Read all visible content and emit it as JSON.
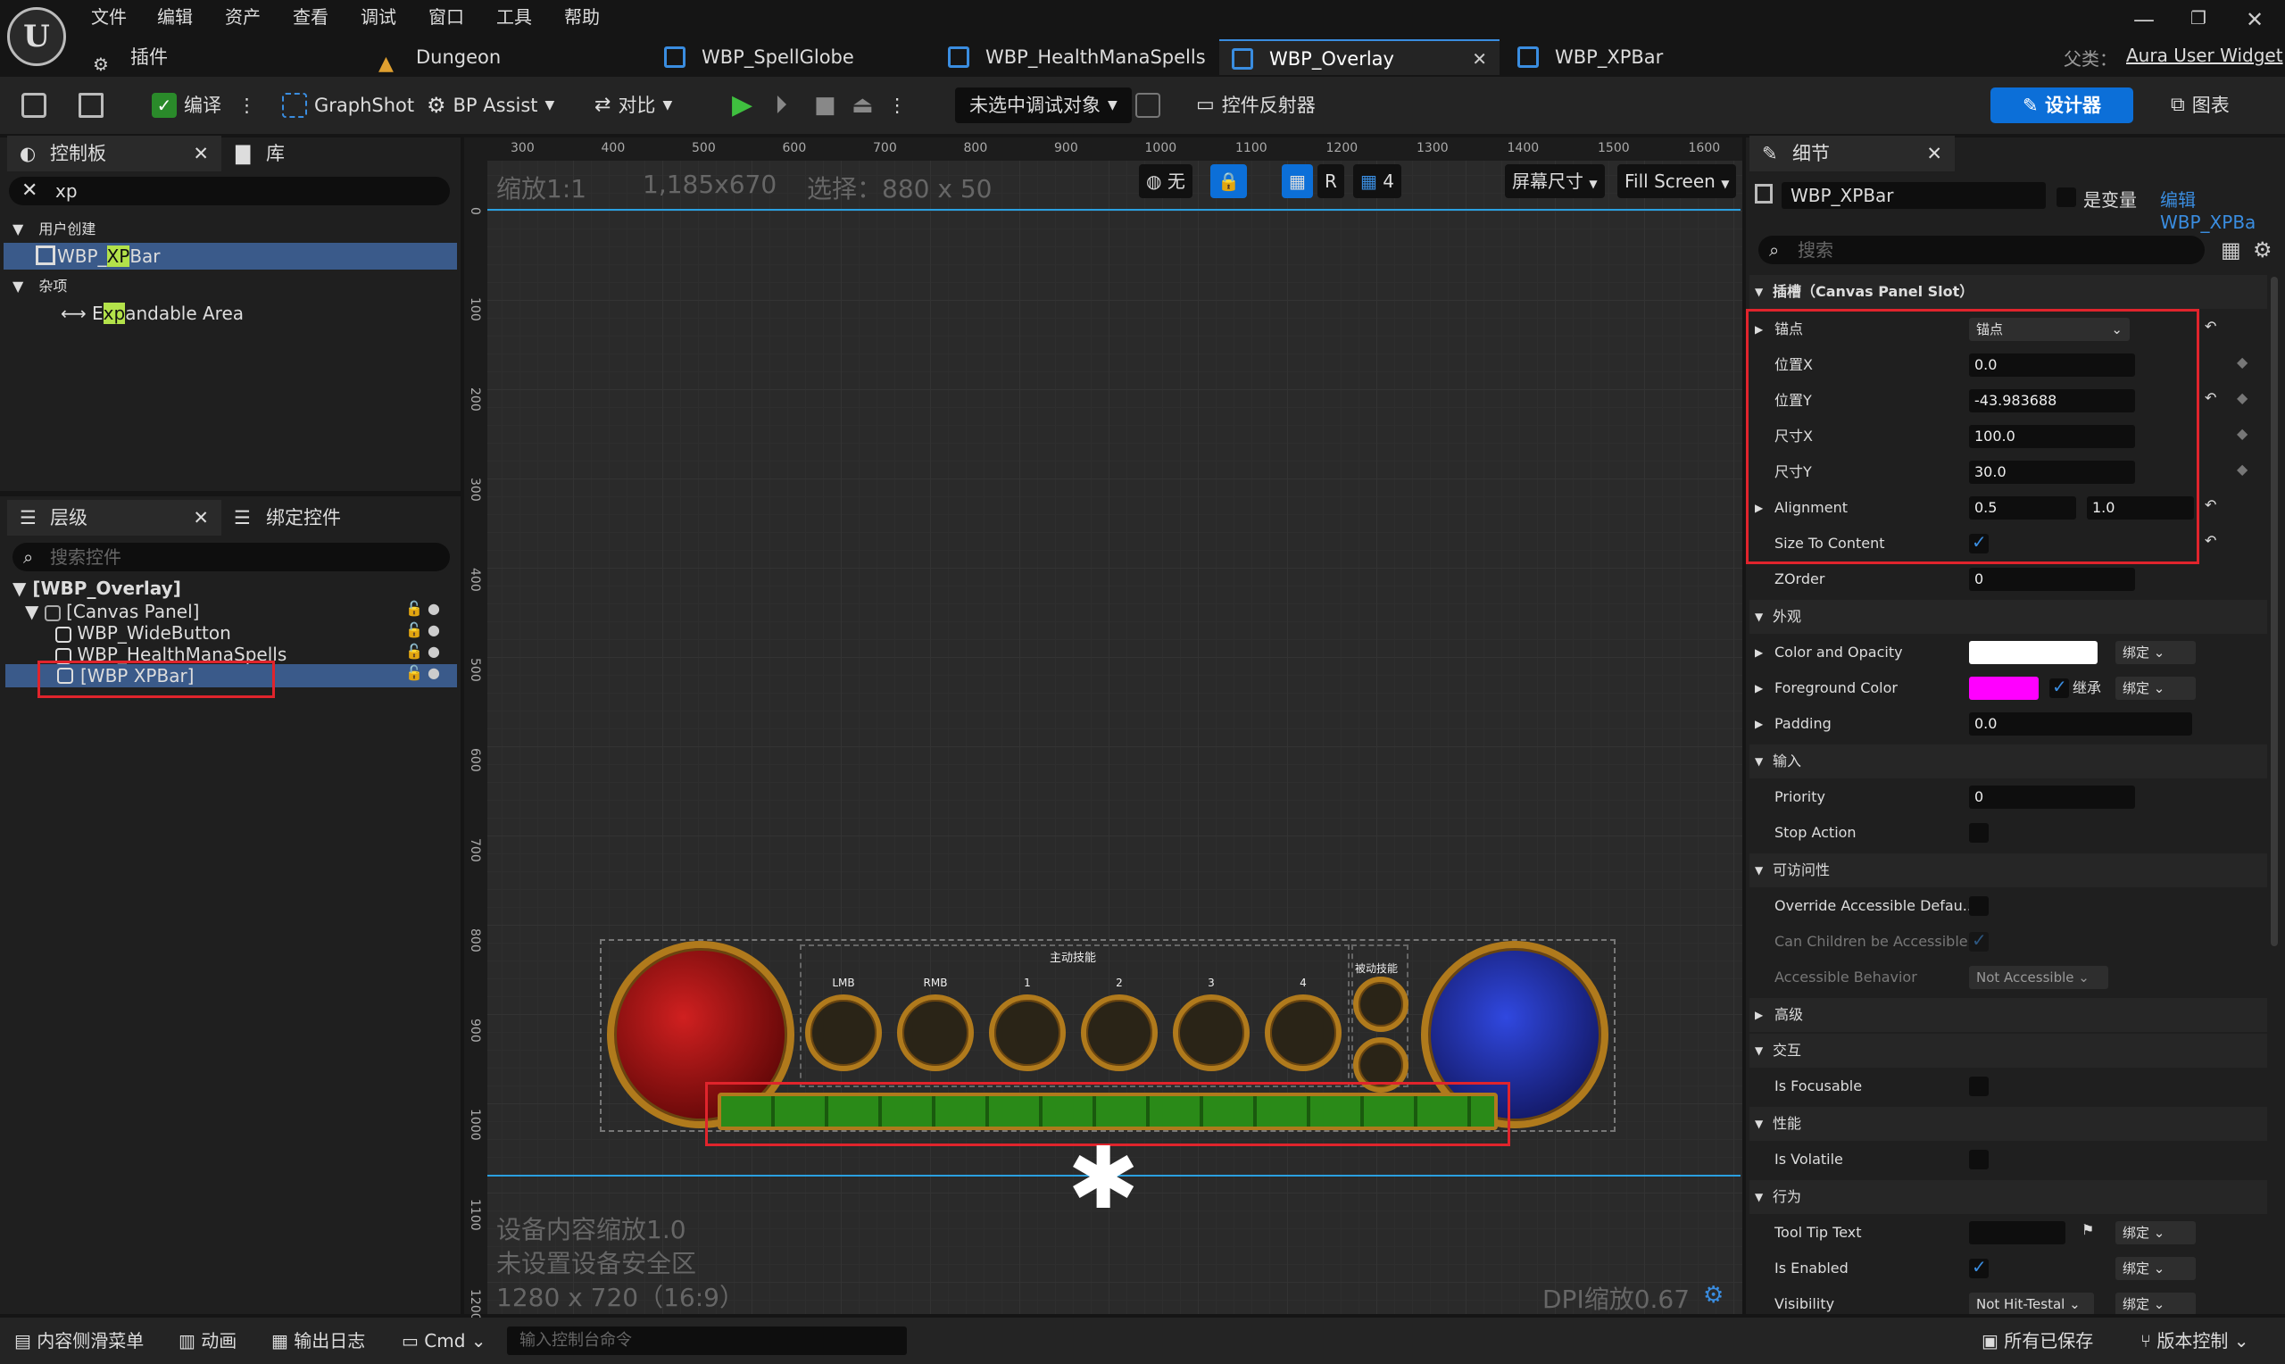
{
  "menu": [
    "文件",
    "编辑",
    "资产",
    "查看",
    "调试",
    "窗口",
    "工具",
    "帮助"
  ],
  "tabs": {
    "plugin": "插件",
    "dungeon": "Dungeon",
    "spellglobe": "WBP_SpellGlobe",
    "healthmana": "WBP_HealthManaSpells",
    "overlay": "WBP_Overlay",
    "xpbar": "WBP_XPBar"
  },
  "parent_label": "父类：",
  "parent_value": "Aura User Widget",
  "toolbar": {
    "compile": "编译",
    "graphshot": "GraphShot",
    "bpassist": "BP Assist",
    "diff": "对比",
    "debug": "未选中调试对象",
    "reflector": "控件反射器",
    "designer": "设计器",
    "graph": "图表"
  },
  "palette": {
    "tab": "控制板",
    "lib": "库",
    "search": "xp",
    "cat1": "用户创建",
    "item1_pre": "WBP_",
    "item1_hl": "XP",
    "item1_post": "Bar",
    "cat2": "杂项",
    "item2_pre": "E",
    "item2_hl": "xp",
    "item2_post": "andable Area"
  },
  "hierarchy": {
    "tab": "层级",
    "bind": "绑定控件",
    "search_placeholder": "搜索控件",
    "root": "[WBP_Overlay]",
    "canvas": "[Canvas Panel]",
    "w1": "WBP_WideButton",
    "w2": "WBP_HealthManaSpells",
    "w3": "[WBP XPBar]"
  },
  "viewport": {
    "zoom": "缩放1:1",
    "res": "1,185x670",
    "selection": "选择：880 x 50",
    "none": "无",
    "screen_size": "屏幕尺寸",
    "fill": "Fill Screen",
    "grid_num": "4",
    "r": "R",
    "scale": "设备内容缩放1.0",
    "safe": "未设置设备安全区",
    "resolution": "1280 x 720（16:9）",
    "dpi": "DPI缩放0.67",
    "ruler_h": [
      "300",
      "400",
      "500",
      "600",
      "700",
      "800",
      "900",
      "1000",
      "1100",
      "1200",
      "1300",
      "1400",
      "1500",
      "1600"
    ],
    "ruler_v": [
      "0",
      "100",
      "200",
      "300",
      "400",
      "500",
      "600",
      "700",
      "800",
      "900",
      "1000",
      "1100",
      "1200"
    ],
    "hud_active": "主动技能",
    "hud_passive": "被动技能",
    "slots": [
      "LMB",
      "RMB",
      "1",
      "2",
      "3",
      "4"
    ]
  },
  "details": {
    "tab": "细节",
    "name": "WBP_XPBar",
    "is_var": "是变量",
    "edit": "编辑WBP_XPBa",
    "search": "搜索",
    "slot_section": "插槽（Canvas Panel Slot）",
    "anchor_label": "锚点",
    "anchor_value": "锚点",
    "posx_label": "位置X",
    "posx": "0.0",
    "posy_label": "位置Y",
    "posy": "-43.983688",
    "sizex_label": "尺寸X",
    "sizex": "100.0",
    "sizey_label": "尺寸Y",
    "sizey": "30.0",
    "align_label": "Alignment",
    "align_x": "0.5",
    "align_y": "1.0",
    "stc_label": "Size To Content",
    "zorder_label": "ZOrder",
    "zorder": "0",
    "appearance": "外观",
    "color_label": "Color and Opacity",
    "bind": "绑定",
    "fg_label": "Foreground Color",
    "inherit": "继承",
    "padding_label": "Padding",
    "padding": "0.0",
    "input": "输入",
    "priority_label": "Priority",
    "priority": "0",
    "stop_label": "Stop Action",
    "access": "可访问性",
    "override_label": "Override Accessible Defau...",
    "children_label": "Can Children be Accessible",
    "behavior_label": "Accessible Behavior",
    "behavior": "Not Accessible",
    "advanced": "高级",
    "interact": "交互",
    "focusable_label": "Is Focusable",
    "perf": "性能",
    "volatile_label": "Is Volatile",
    "behavior_sec": "行为",
    "tooltip_label": "Tool Tip Text",
    "enabled_label": "Is Enabled",
    "visibility_label": "Visibility",
    "visibility": "Not Hit-Testal"
  },
  "bottom": {
    "drawer": "内容侧滑菜单",
    "anim": "动画",
    "log": "输出日志",
    "cmd": "Cmd",
    "console": "输入控制台命令",
    "saved": "所有已保存",
    "vcs": "版本控制"
  },
  "colors": {
    "accent": "#0c6fd8",
    "highlight": "#b3e24a",
    "selection_red": "#e0242c",
    "fg_color": "#ff00ff",
    "health": "#b00000",
    "mana": "#1a2ec0",
    "xp": "#2a8a18"
  }
}
